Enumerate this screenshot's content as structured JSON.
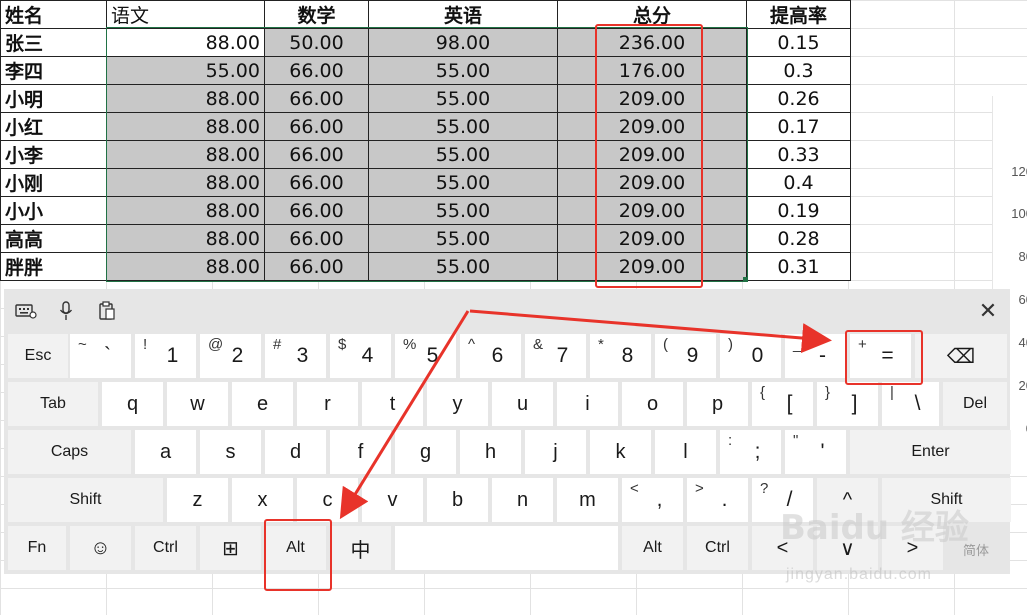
{
  "sheet": {
    "headers": [
      "姓名",
      "语文",
      "数学",
      "英语",
      "总分",
      "提高率"
    ],
    "rows": [
      {
        "name": "张三",
        "chinese": "88.00",
        "math": "50.00",
        "english": "98.00",
        "total": "236.00",
        "rate": "0.15"
      },
      {
        "name": "李四",
        "chinese": "55.00",
        "math": "66.00",
        "english": "55.00",
        "total": "176.00",
        "rate": "0.3"
      },
      {
        "name": "小明",
        "chinese": "88.00",
        "math": "66.00",
        "english": "55.00",
        "total": "209.00",
        "rate": "0.26"
      },
      {
        "name": "小红",
        "chinese": "88.00",
        "math": "66.00",
        "english": "55.00",
        "total": "209.00",
        "rate": "0.17"
      },
      {
        "name": "小李",
        "chinese": "88.00",
        "math": "66.00",
        "english": "55.00",
        "total": "209.00",
        "rate": "0.33"
      },
      {
        "name": "小刚",
        "chinese": "88.00",
        "math": "66.00",
        "english": "55.00",
        "total": "209.00",
        "rate": "0.4"
      },
      {
        "name": "小小",
        "chinese": "88.00",
        "math": "66.00",
        "english": "55.00",
        "total": "209.00",
        "rate": "0.19"
      },
      {
        "name": "高高",
        "chinese": "88.00",
        "math": "66.00",
        "english": "55.00",
        "total": "209.00",
        "rate": "0.28"
      },
      {
        "name": "胖胖",
        "chinese": "88.00",
        "math": "66.00",
        "english": "55.00",
        "total": "209.00",
        "rate": "0.31"
      }
    ]
  },
  "chart_axis_ticks": [
    "120",
    "100",
    "80",
    "60",
    "40",
    "20",
    "0"
  ],
  "keyboard": {
    "toolbar": {
      "close": "✕"
    },
    "row1": [
      {
        "label": "Esc"
      },
      {
        "sym": "~",
        "label": "`"
      },
      {
        "sym": "!",
        "label": "1"
      },
      {
        "sym": "@",
        "label": "2"
      },
      {
        "sym": "#",
        "label": "3"
      },
      {
        "sym": "$",
        "label": "4"
      },
      {
        "sym": "%",
        "label": "5"
      },
      {
        "sym": "^",
        "label": "6"
      },
      {
        "sym": "&",
        "label": "7"
      },
      {
        "sym": "*",
        "label": "8"
      },
      {
        "sym": "(",
        "label": "9"
      },
      {
        "sym": ")",
        "label": "0"
      },
      {
        "sym": "_",
        "label": "-"
      },
      {
        "sym": "+",
        "label": "="
      },
      {
        "label": "⌫"
      }
    ],
    "row2": [
      {
        "label": "Tab"
      },
      {
        "label": "q"
      },
      {
        "label": "w"
      },
      {
        "label": "e"
      },
      {
        "label": "r"
      },
      {
        "label": "t"
      },
      {
        "label": "y"
      },
      {
        "label": "u"
      },
      {
        "label": "i"
      },
      {
        "label": "o"
      },
      {
        "label": "p"
      },
      {
        "sym": "{",
        "label": "["
      },
      {
        "sym": "}",
        "label": "]"
      },
      {
        "sym": "|",
        "label": "\\"
      },
      {
        "label": "Del"
      }
    ],
    "row3": [
      {
        "label": "Caps"
      },
      {
        "label": "a"
      },
      {
        "label": "s"
      },
      {
        "label": "d"
      },
      {
        "label": "f"
      },
      {
        "label": "g"
      },
      {
        "label": "h"
      },
      {
        "label": "j"
      },
      {
        "label": "k"
      },
      {
        "label": "l"
      },
      {
        "sym": ":",
        "label": ";"
      },
      {
        "sym": "\"",
        "label": "'"
      },
      {
        "label": "Enter"
      }
    ],
    "row4": [
      {
        "label": "Shift"
      },
      {
        "label": "z"
      },
      {
        "label": "x"
      },
      {
        "label": "c"
      },
      {
        "label": "v"
      },
      {
        "label": "b"
      },
      {
        "label": "n"
      },
      {
        "label": "m"
      },
      {
        "sym": "<",
        "label": ","
      },
      {
        "sym": ">",
        "label": "."
      },
      {
        "sym": "?",
        "label": "/"
      },
      {
        "label": "^"
      },
      {
        "label": "Shift"
      }
    ],
    "row5": [
      {
        "label": "Fn"
      },
      {
        "label": "☺"
      },
      {
        "label": "Ctrl"
      },
      {
        "label": "⊞"
      },
      {
        "label": "Alt"
      },
      {
        "label": "中"
      },
      {
        "label": ""
      },
      {
        "label": "Alt"
      },
      {
        "label": "Ctrl"
      },
      {
        "label": "<"
      },
      {
        "label": "∨"
      },
      {
        "label": ">"
      }
    ]
  },
  "watermark": {
    "logo": "Baidu 经验",
    "url": "jingyan.baidu.com",
    "ime_tag": "简体"
  },
  "colors": {
    "highlight": "#e8332a",
    "selection": "#c8c8c8",
    "excel_green": "#207245"
  }
}
